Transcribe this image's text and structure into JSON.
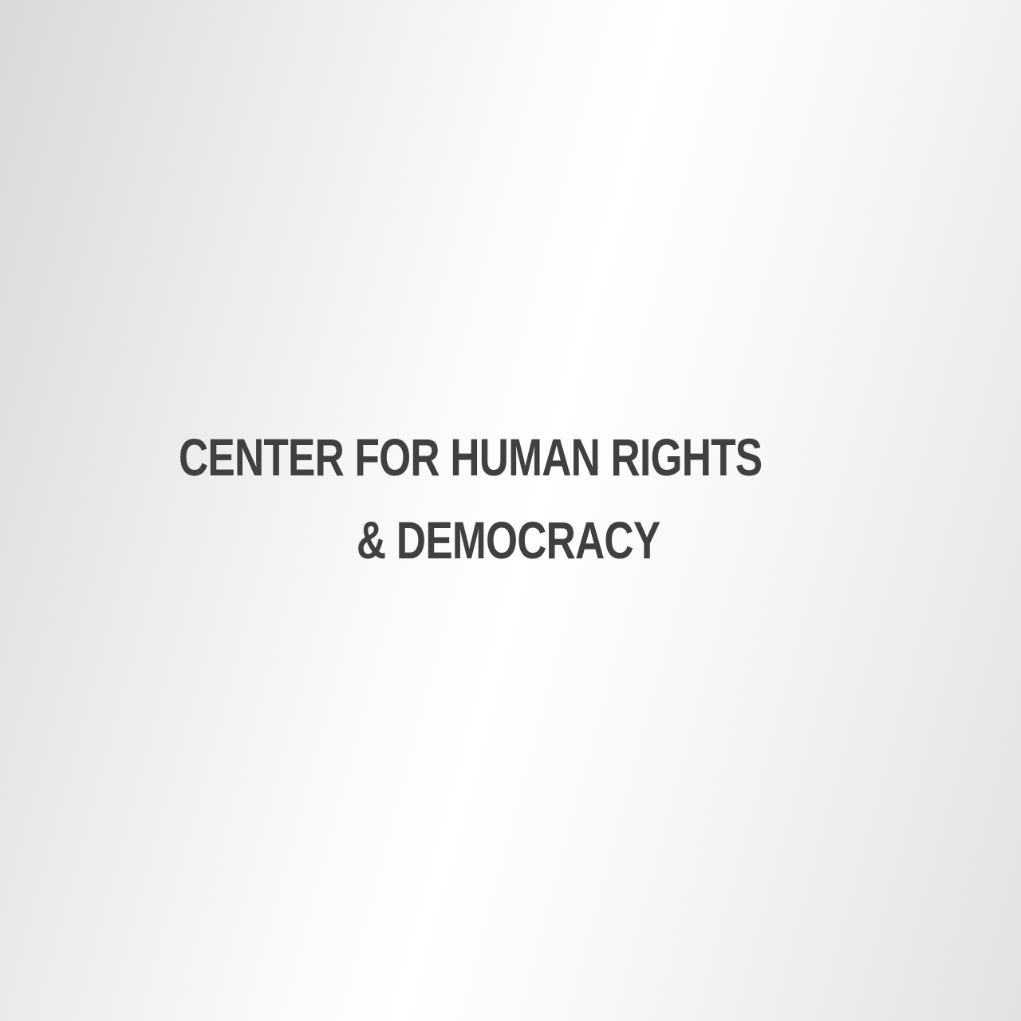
{
  "logo": {
    "line1": "CENTER FOR HUMAN RIGHTS",
    "line2": "& DEMOCRACY",
    "text_color": "#404040",
    "background_colors": [
      "#d9d9d9",
      "#ffffff",
      "#e2e2e2"
    ]
  }
}
